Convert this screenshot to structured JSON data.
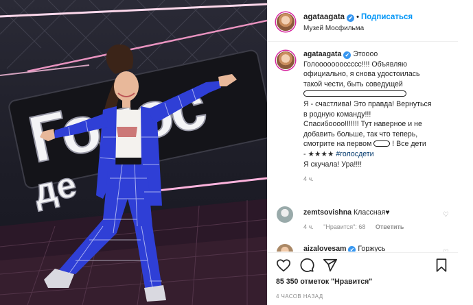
{
  "post": {
    "username": "agataagata",
    "verified_mark": "✔",
    "separator": "•",
    "follow_label": "Подписаться",
    "location": "Музей Мосфильма"
  },
  "photo": {
    "sign_text": "Голос",
    "sign_sub": "де"
  },
  "caption": {
    "username": "agataagata",
    "line1": "Этоооо",
    "line2": "Голоооооооссссс!!!! Объявляю",
    "line3": "официально, я снова удостоилась",
    "line4": "такой чести, быть соведущей",
    "line6": "Я - счастлива! Это правда! Вернуться",
    "line7": "в родную команду!!!",
    "line8": "Спасибоооо!!!!!!! Тут наверное и не",
    "line9": "добавить больше, так что теперь,",
    "line10a": "смотрите на первом",
    "line10b": "! Все дети",
    "line11a": "- ★★★★ ",
    "line11b": "#голосдети",
    "line12": "Я скучала! Ура!!!!",
    "time": "4 ч."
  },
  "comments": [
    {
      "username": "zemtsovishna",
      "text": "Классная♥",
      "time": "4 ч.",
      "likes": "\"Нравится\": 68",
      "reply": "Ответить"
    },
    {
      "username": "aizalovesam",
      "text": "Горжусь",
      "verified_mark": "✔"
    }
  ],
  "actions": {
    "like": "heart-icon",
    "comment": "comment-icon",
    "share": "share-icon",
    "save": "bookmark-icon"
  },
  "likes_text": "85 350 отметок \"Нравится\"",
  "posted_ago": "4 ЧАСОВ НАЗАД",
  "colors": {
    "link_blue": "#0095f6",
    "verified_blue": "#3897f0",
    "suit_blue": "#2f3fd6",
    "muted": "#8e8e8e"
  }
}
